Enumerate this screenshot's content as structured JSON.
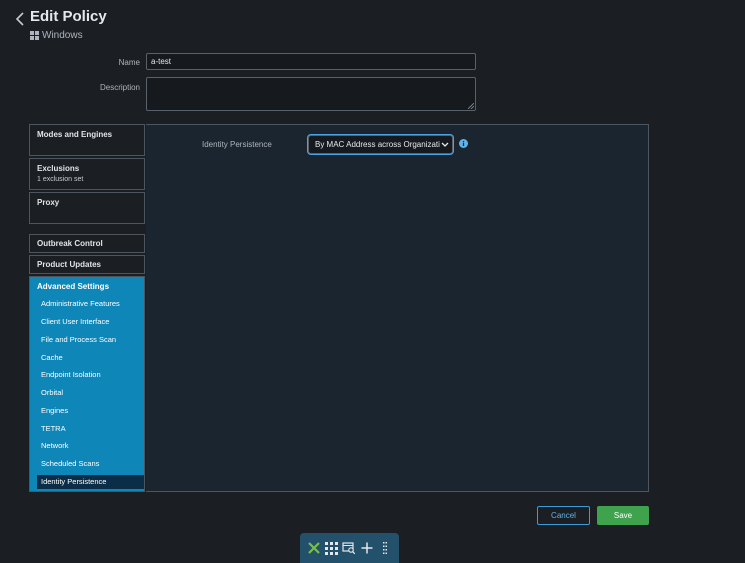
{
  "header": {
    "title": "Edit Policy",
    "os": "Windows"
  },
  "form": {
    "name_label": "Name",
    "name_value": "a-test",
    "description_label": "Description",
    "description_value": ""
  },
  "nav": {
    "modes": {
      "title": "Modes and Engines"
    },
    "exclusions": {
      "title": "Exclusions",
      "sub": "1 exclusion set"
    },
    "proxy": {
      "title": "Proxy"
    },
    "outbreak": {
      "title": "Outbreak Control"
    },
    "updates": {
      "title": "Product Updates"
    },
    "advanced": {
      "title": "Advanced Settings",
      "items": [
        {
          "label": "Administrative Features"
        },
        {
          "label": "Client User Interface"
        },
        {
          "label": "File and Process Scan"
        },
        {
          "label": "Cache"
        },
        {
          "label": "Endpoint Isolation"
        },
        {
          "label": "Orbital"
        },
        {
          "label": "Engines"
        },
        {
          "label": "TETRA"
        },
        {
          "label": "Network"
        },
        {
          "label": "Scheduled Scans"
        },
        {
          "label": "Identity Persistence"
        }
      ],
      "active": "Identity Persistence"
    }
  },
  "content": {
    "identity_label": "Identity Persistence",
    "identity_value": "By MAC Address across Organizati"
  },
  "buttons": {
    "cancel": "Cancel",
    "save": "Save"
  },
  "taskbar": {
    "icons": [
      "x-logo-icon",
      "apps-grid-icon",
      "window-search-icon",
      "plus-icon",
      "more-vertical-icon"
    ]
  },
  "colors": {
    "background": "#1b1f24",
    "advanced_panel": "#0f86b8",
    "active_item": "#0c2d47",
    "save_green": "#3fa34d",
    "cancel_blue": "#5fb3e6",
    "logo_green": "#7ac143"
  }
}
